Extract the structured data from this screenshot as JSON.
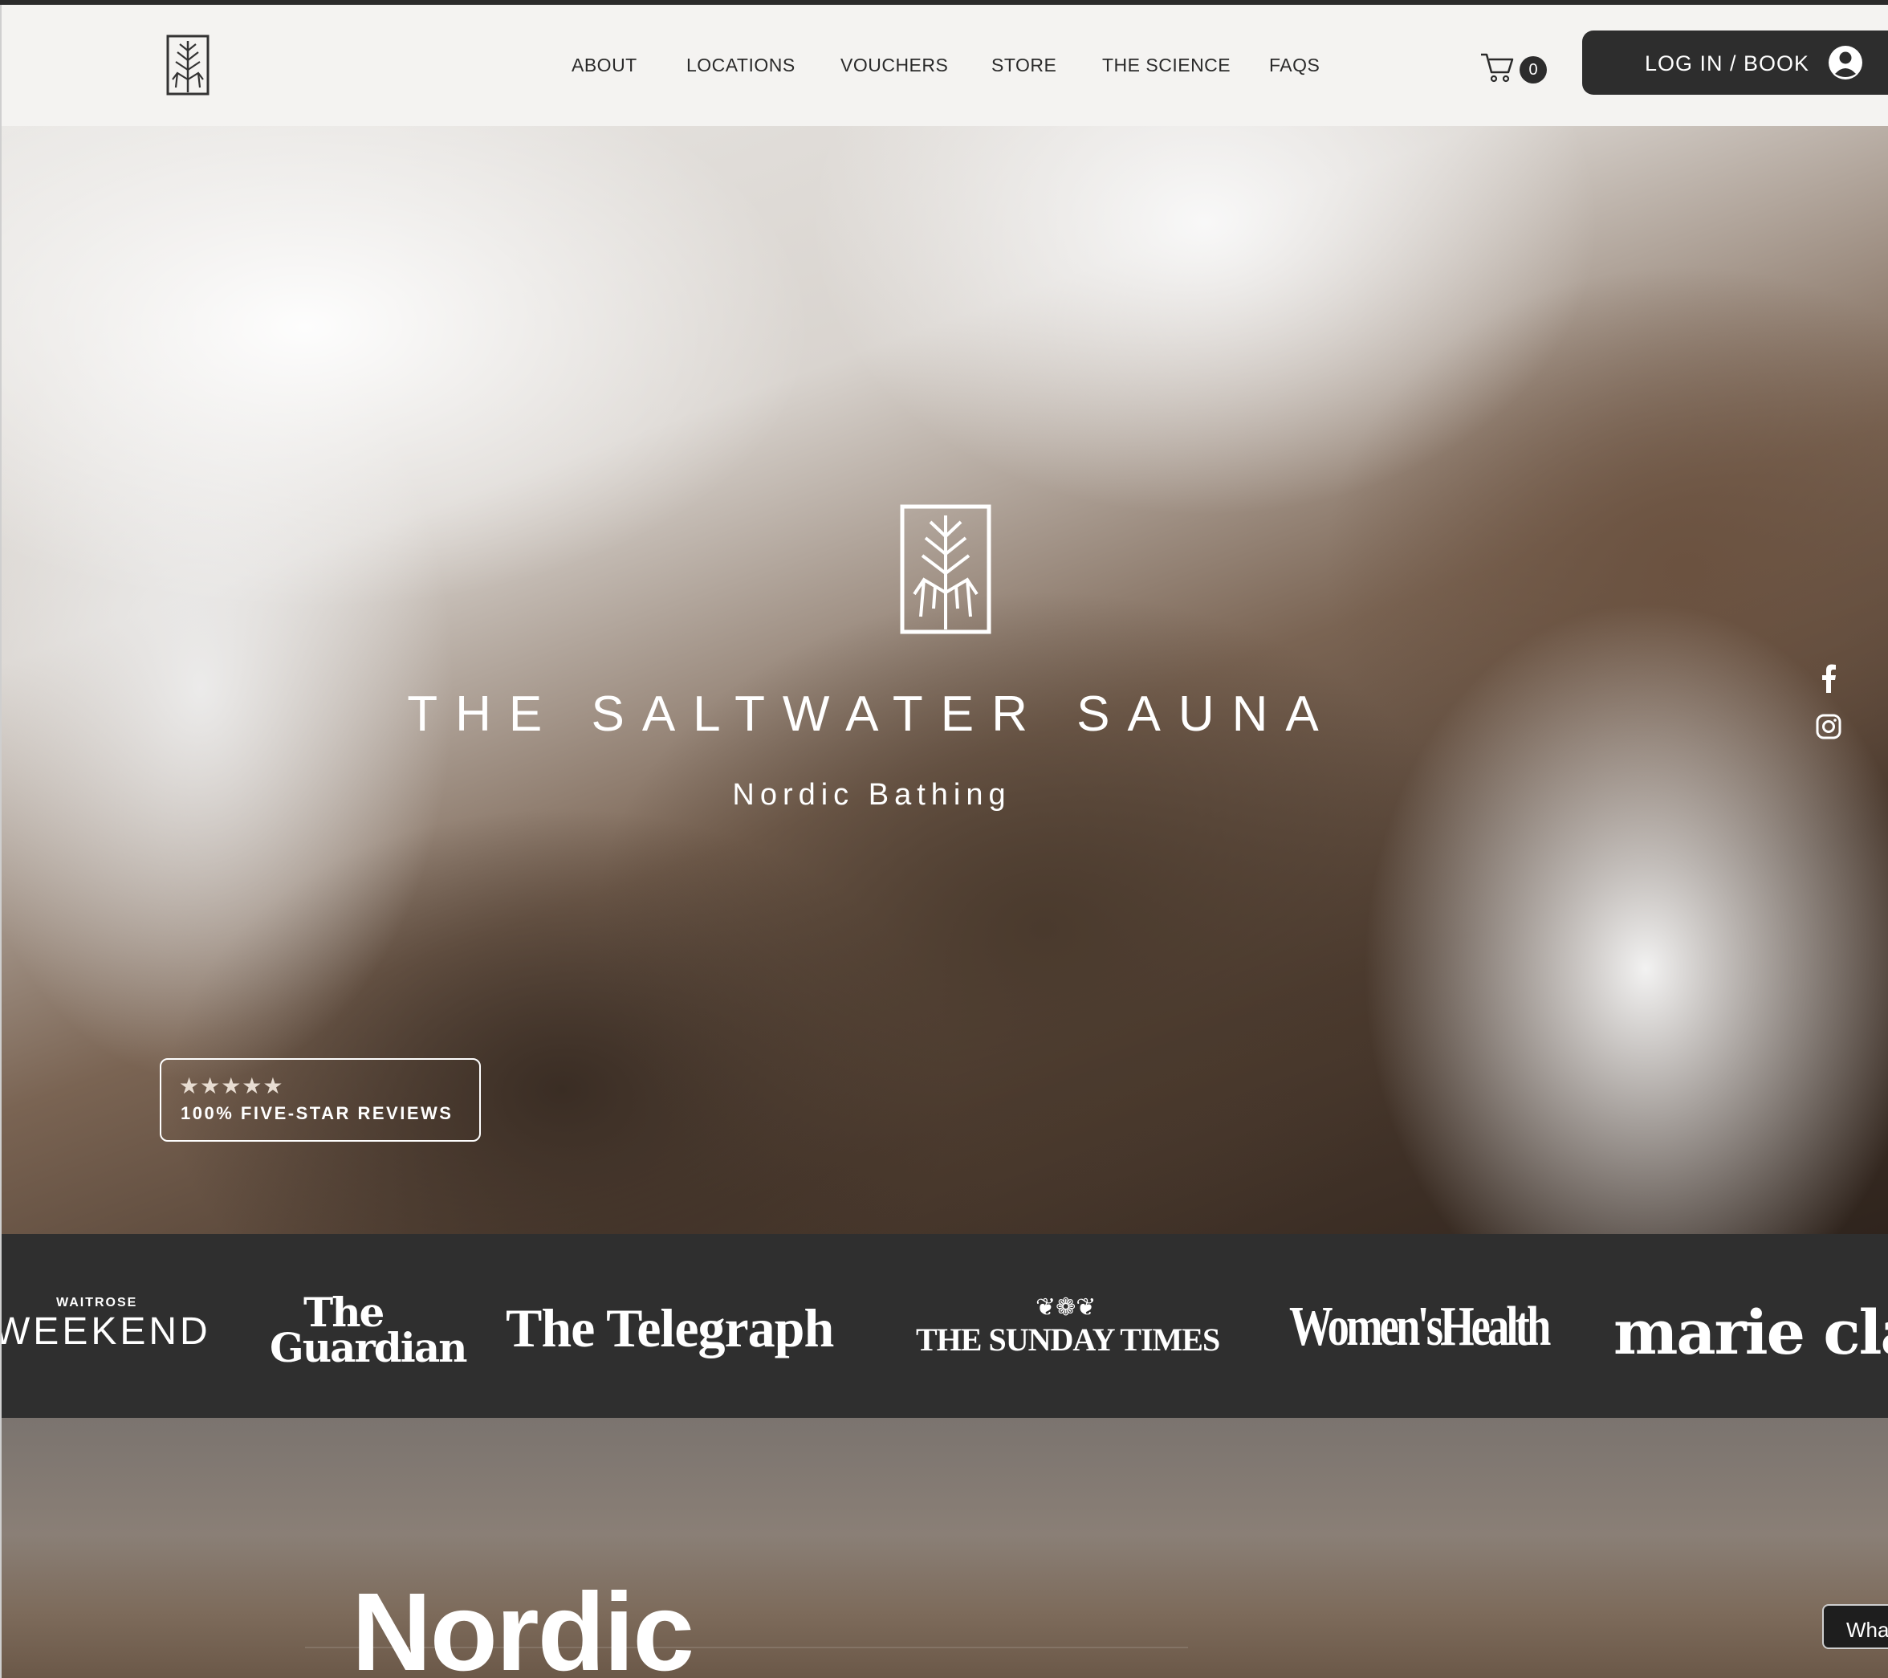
{
  "header": {
    "nav": [
      "ABOUT",
      "LOCATIONS",
      "VOUCHERS",
      "STORE",
      "THE SCIENCE",
      "FAQS"
    ],
    "cart_count": "0",
    "login_label": "LOG IN / BOOK"
  },
  "hero": {
    "title": "THE SALTWATER SAUNA",
    "subtitle": "Nordic Bathing",
    "reviews": {
      "stars": "★★★★★",
      "rating_stars": 5,
      "label": "100% FIVE-STAR REVIEWS"
    },
    "social": [
      "facebook-icon",
      "instagram-icon"
    ]
  },
  "press": {
    "waitrose_small": "WAITROSE",
    "weekend": "WEEKEND",
    "guardian_line1": "The",
    "guardian_line2": "Guardian",
    "telegraph": "The Telegraph",
    "sunday_times": "THE SUNDAY TIMES",
    "womens_health": "Women'sHealth",
    "marie_claire": "marie cla"
  },
  "lower": {
    "heading": "Nordic"
  },
  "chat": {
    "label": "Wha"
  },
  "colors": {
    "header_bg": "#f4f3f1",
    "nav_text": "#2a2a2a",
    "button_dark": "#2d2d2d",
    "press_bg": "#2f2f2f"
  }
}
